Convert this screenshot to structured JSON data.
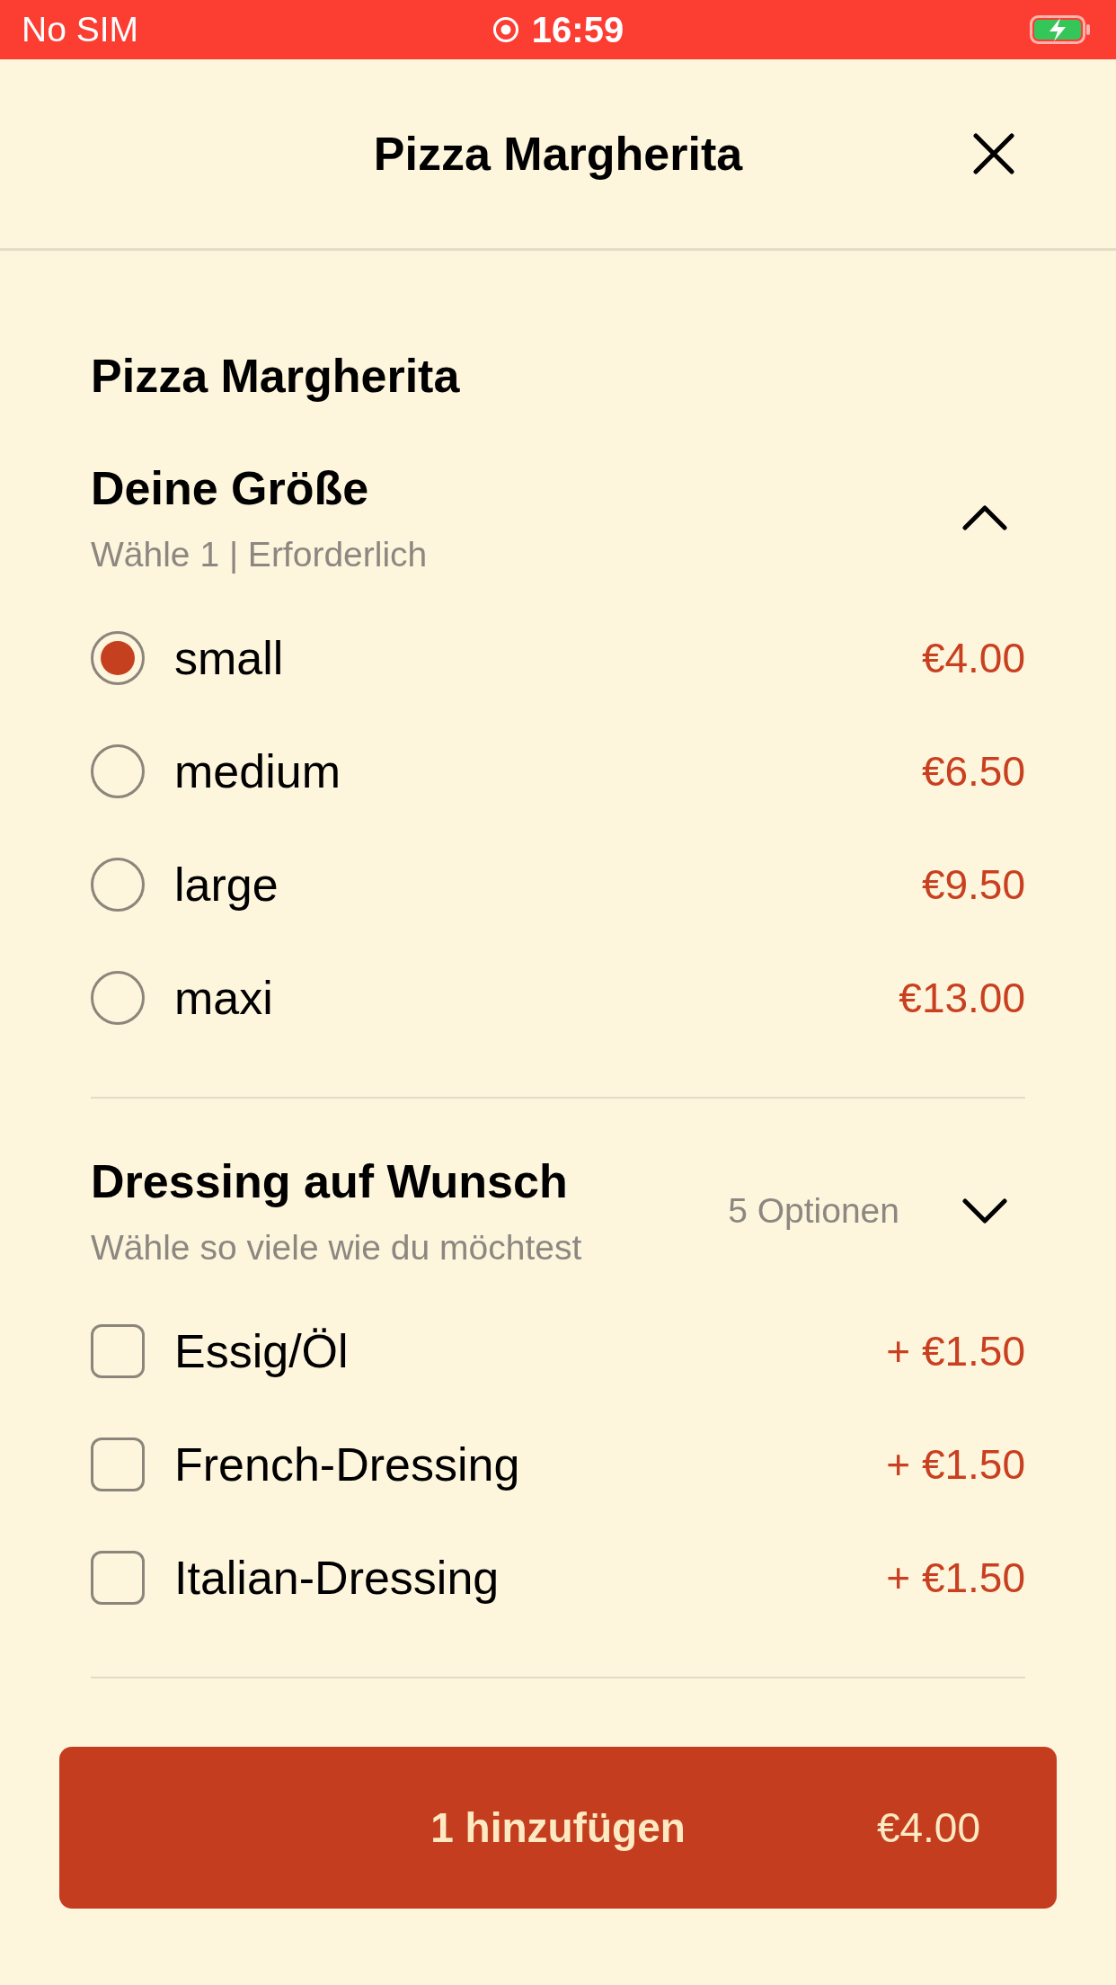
{
  "status_bar": {
    "carrier": "No SIM",
    "time": "16:59"
  },
  "header": {
    "title": "Pizza Margherita"
  },
  "product": {
    "name": "Pizza Margherita"
  },
  "sections": [
    {
      "kind": "radio",
      "title": "Deine Größe",
      "subtitle": "Wähle 1 | Erforderlich",
      "expanded": true,
      "options": [
        {
          "label": "small",
          "price": "€4.00",
          "selected": true
        },
        {
          "label": "medium",
          "price": "€6.50",
          "selected": false
        },
        {
          "label": "large",
          "price": "€9.50",
          "selected": false
        },
        {
          "label": "maxi",
          "price": "€13.00",
          "selected": false
        }
      ]
    },
    {
      "kind": "checkbox",
      "title": "Dressing auf Wunsch",
      "subtitle": "Wähle so viele wie du möchtest",
      "count": "5 Optionen",
      "expanded": false,
      "options": [
        {
          "label": "Essig/Öl",
          "price": "+ €1.50",
          "checked": false
        },
        {
          "label": "French-Dressing",
          "price": "+ €1.50",
          "checked": false
        },
        {
          "label": "Italian-Dressing",
          "price": "+ €1.50",
          "checked": false
        }
      ]
    }
  ],
  "add_button": {
    "label": "1 hinzufügen",
    "price": "€4.00"
  }
}
